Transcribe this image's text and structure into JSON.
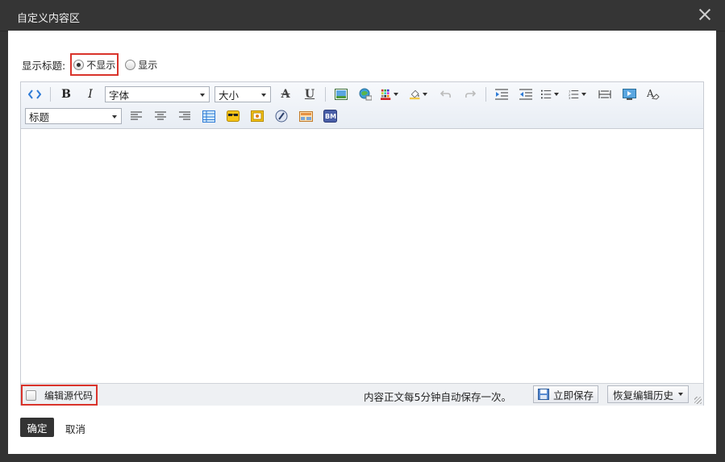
{
  "dialog": {
    "title": "自定义内容区",
    "close_icon": "close-icon"
  },
  "show_title": {
    "label": "显示标题:",
    "options": [
      {
        "label": "不显示",
        "selected": true
      },
      {
        "label": "显示",
        "selected": false
      }
    ]
  },
  "toolbar": {
    "font_select": "字体",
    "size_select": "大小",
    "heading_select": "标题",
    "bold": "B",
    "italic": "I",
    "strike": "A",
    "underline": "U",
    "bm": "BM"
  },
  "statusbar": {
    "source_code_label": "编辑源代码",
    "autosave_text": "内容正文每5分钟自动保存一次。",
    "save_now": "立即保存",
    "restore_history": "恢复编辑历史"
  },
  "footer": {
    "ok": "确定",
    "cancel": "取消"
  },
  "colors": {
    "highlight_border": "#d9332b",
    "title_bar": "#353535",
    "ok_button": "#333333"
  }
}
